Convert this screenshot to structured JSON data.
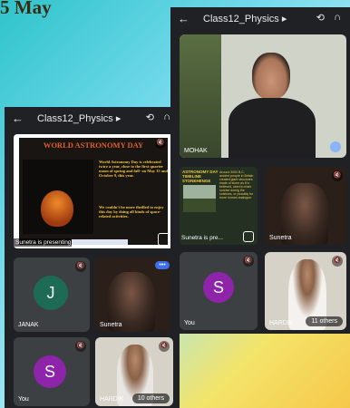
{
  "background_text": "5  May",
  "left_window": {
    "title": "Class12_Physics",
    "presentation": {
      "title": "WORLD ASTRONOMY DAY",
      "text_1": "World Astronomy Day is celebrated twice a year, close to the first quarter moon of spring and fall- on May 15 and October 9, this year.",
      "text_2": "We couldn't be more thrilled to enjoy this day by doing all kinds of space-related activities.",
      "caption": "Sunetra is presenting"
    },
    "participants": [
      {
        "name": "JANAK",
        "initial": "J",
        "avatar_color": "#1e6b55"
      },
      {
        "name": "Sunetra"
      },
      {
        "name": "You",
        "initial": "S",
        "avatar_color": "#8e24aa"
      },
      {
        "name": "HARDIK",
        "badge": "10 others"
      }
    ]
  },
  "right_window": {
    "title": "Class12_Physics",
    "main_speaker": {
      "name": "MOHAK"
    },
    "presentation": {
      "title": "ASTRONOMY DAY TIMELINE STONEHENGE",
      "text": "Around 3000 B.C. ancient people in Britain created giant structures made of stone as it is believed, used to mark sunrise during the solstices, or possibly for more human analogue.",
      "caption": "Sunetra is pre..."
    },
    "participants": [
      {
        "name": "Sunetra"
      },
      {
        "name": "You",
        "initial": "S",
        "avatar_color": "#8e24aa"
      },
      {
        "name": "HARDIK",
        "badge": "11 others"
      }
    ]
  },
  "icons": {
    "back": "arrow-left-icon",
    "camera_flip": "camera-flip-icon",
    "audio": "headphones-icon",
    "mic_off": "mic-off-icon"
  }
}
